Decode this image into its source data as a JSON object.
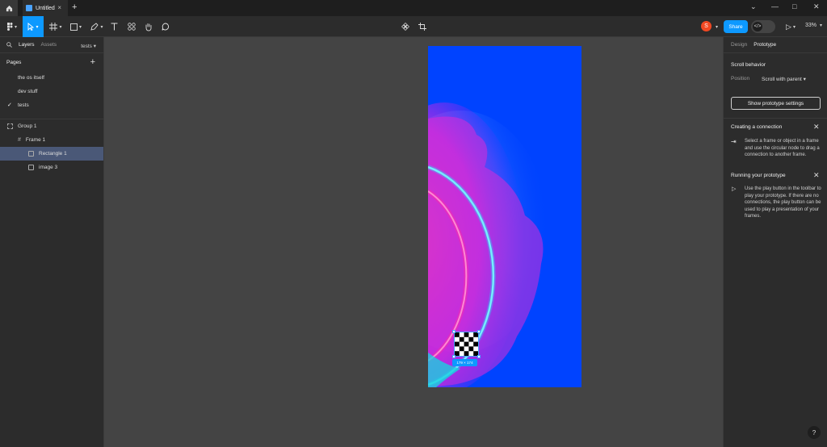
{
  "titlebar": {
    "tab_title": "Untitled",
    "tab_close": "×",
    "new_tab": "+",
    "minimize": "—",
    "maximize": "□",
    "close": "✕",
    "dropdown": "⌄"
  },
  "toolbar": {
    "avatar_letter": "S",
    "share_label": "Share",
    "dev_mode_glyph": "</>",
    "play_glyph": "▷",
    "zoom": "33%"
  },
  "left_panel": {
    "tabs": [
      "Layers",
      "Assets"
    ],
    "page_selector": "tests",
    "pages_heading": "Pages",
    "pages": [
      {
        "label": "the os itself",
        "selected": false
      },
      {
        "label": "dev stuff",
        "selected": false
      },
      {
        "label": "tests",
        "selected": true
      }
    ],
    "layers": [
      {
        "label": "Group 1"
      },
      {
        "label": "Frame 1"
      },
      {
        "label": "Rectangle 1"
      },
      {
        "label": "image 3"
      }
    ]
  },
  "canvas": {
    "dimension_label": "179 × 174"
  },
  "right_panel": {
    "tabs": [
      "Design",
      "Prototype"
    ],
    "scroll_behavior_title": "Scroll behavior",
    "position_label": "Position",
    "position_value": "Scroll with parent",
    "show_settings_button": "Show prototype settings",
    "creating_title": "Creating a connection",
    "creating_text": "Select a frame or object in a frame and use the circular node to drag a connection to another frame.",
    "running_title": "Running your prototype",
    "running_text": "Use the play button in the toolbar to play your prototype. If there are no connections, the play button can be used to play a presentation of your frames."
  },
  "help_glyph": "?",
  "colors": {
    "accent": "#0d99ff",
    "frame_bg": "#0043ff",
    "canvas_bg": "#444444",
    "panel_bg": "#2c2c2c",
    "avatar": "#f24822"
  }
}
